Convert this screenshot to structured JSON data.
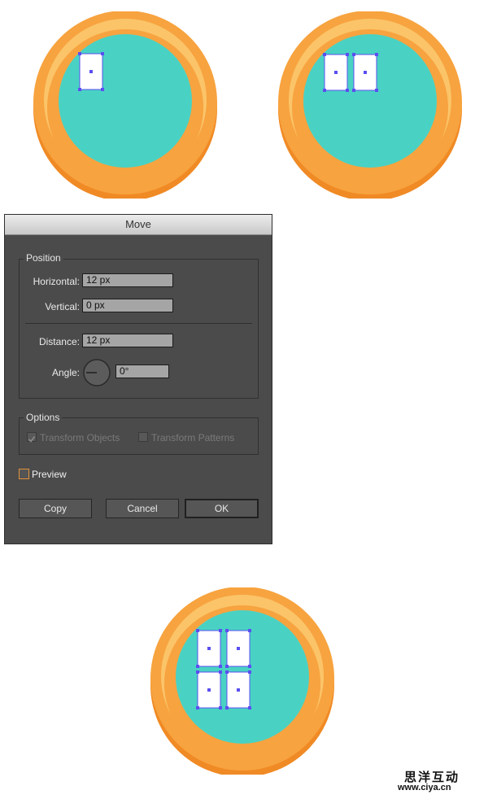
{
  "colors": {
    "orange_dark": "#f08a25",
    "orange": "#f7a33f",
    "orange_light": "#fbc469",
    "teal": "#49d2c4",
    "selection": "#5a4ff0",
    "dialog_bg": "#4b4b4b"
  },
  "dialog": {
    "title": "Move",
    "position_group": "Position",
    "horizontal_label": "Horizontal:",
    "horizontal_value": "12 px",
    "vertical_label": "Vertical:",
    "vertical_value": "0 px",
    "distance_label": "Distance:",
    "distance_value": "12 px",
    "angle_label": "Angle:",
    "angle_value": "0°",
    "options_group": "Options",
    "transform_objects_label": "Transform Objects",
    "transform_objects_checked": true,
    "transform_patterns_label": "Transform Patterns",
    "transform_patterns_checked": false,
    "preview_label": "Preview",
    "preview_checked": false,
    "copy_label": "Copy",
    "cancel_label": "Cancel",
    "ok_label": "OK"
  },
  "illustrations": [
    {
      "name": "circle-top-left",
      "selected_cards": 1
    },
    {
      "name": "circle-top-right",
      "selected_cards": 2
    },
    {
      "name": "circle-bottom",
      "selected_cards": 4
    }
  ],
  "watermark": {
    "line1": "思洋互动",
    "line2": "www.ciya.cn"
  }
}
